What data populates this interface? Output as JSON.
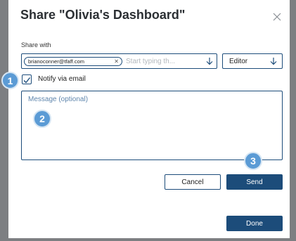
{
  "dialog": {
    "title": "Share \"Olivia's Dashboard\""
  },
  "share": {
    "label": "Share with",
    "chip_email": "brianoconner@tfaff.com",
    "recipient_placeholder": "Start typing th..."
  },
  "role": {
    "value": "Editor"
  },
  "notify": {
    "label": "Notify via email",
    "checked": true
  },
  "message": {
    "placeholder": "Message (optional)"
  },
  "buttons": {
    "cancel": "Cancel",
    "send": "Send",
    "done": "Done"
  },
  "badges": [
    "1",
    "2",
    "3"
  ],
  "colors": {
    "primary": "#1c4c7a",
    "badge": "#5b9bd5",
    "backdrop": "#7d7f82"
  },
  "icons": {
    "close": "close-icon",
    "chip_remove": "close-icon",
    "recipient_dropdown": "arrow-down-icon",
    "role_dropdown": "arrow-down-icon",
    "notify_check": "checkmark-icon"
  }
}
